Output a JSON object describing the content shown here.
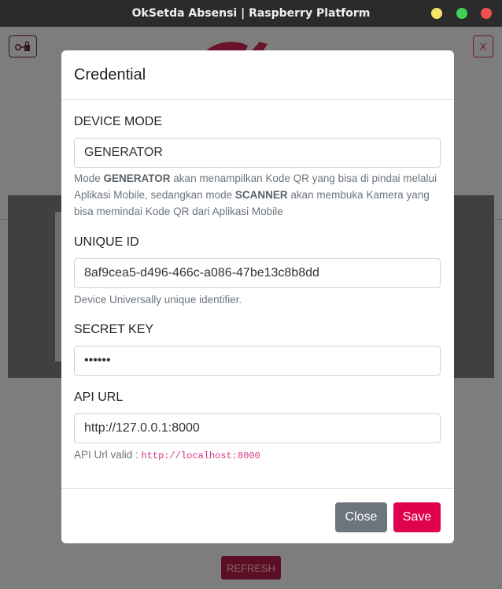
{
  "window": {
    "title": "OkSetda Absensi | Raspberry Platform"
  },
  "background": {
    "close_label": "X",
    "refresh_label": "REFRESH"
  },
  "modal": {
    "title": "Credential",
    "device_mode": {
      "label": "DEVICE MODE",
      "value": "GENERATOR",
      "help_parts": [
        "Mode ",
        "GENERATOR",
        " akan menampilkan Kode QR yang bisa di pindai melalui Aplikasi Mobile, sedangkan mode ",
        "SCANNER",
        " akan membuka Kamera yang bisa memindai Kode QR dari Aplikasi Mobile"
      ]
    },
    "unique_id": {
      "label": "UNIQUE ID",
      "value": "8af9cea5-d496-466c-a086-47be13c8b8dd",
      "help": "Device Universally unique identifier."
    },
    "secret_key": {
      "label": "SECRET KEY",
      "value": "••••••"
    },
    "api_url": {
      "label": "API URL",
      "value": "http://127.0.0.1:8000",
      "help_prefix": "API Url valid : ",
      "help_code": "http://localhost:8000"
    },
    "buttons": {
      "close": "Close",
      "save": "Save"
    }
  },
  "colors": {
    "primary": "#e0004d",
    "secondary": "#6c757d",
    "code": "#d63384"
  },
  "icons": {
    "lock": "lock-key-icon",
    "close": "close-icon"
  }
}
